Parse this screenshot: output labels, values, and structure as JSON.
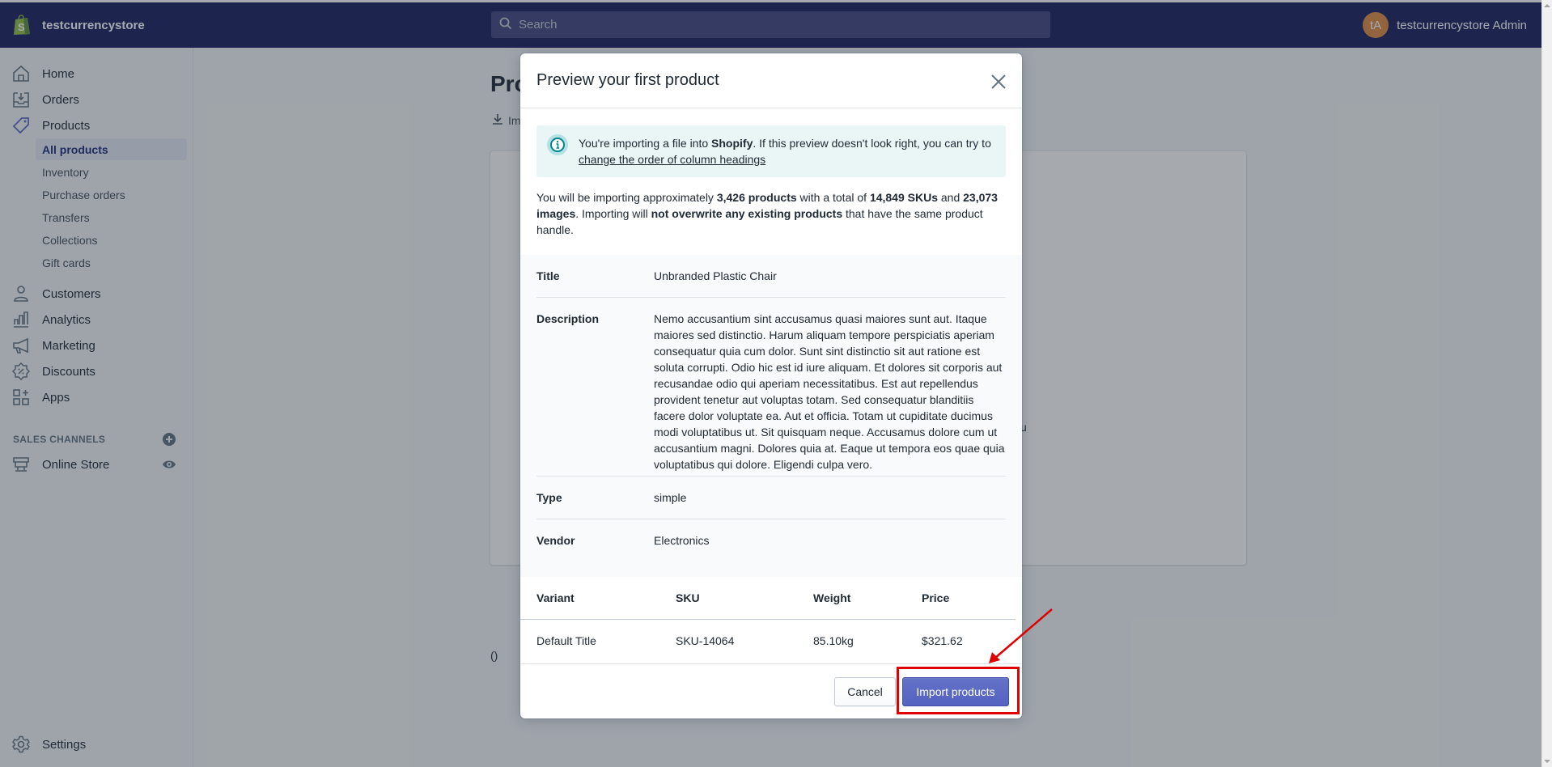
{
  "topbar": {
    "store_name": "testcurrencystore",
    "search_placeholder": "Search",
    "user_initials": "tA",
    "user_name": "testcurrencystore Admin"
  },
  "sidebar": {
    "items": [
      {
        "label": "Home",
        "icon": "home-icon"
      },
      {
        "label": "Orders",
        "icon": "orders-icon"
      },
      {
        "label": "Products",
        "icon": "tag-icon"
      },
      {
        "label": "Customers",
        "icon": "customer-icon"
      },
      {
        "label": "Analytics",
        "icon": "analytics-icon"
      },
      {
        "label": "Marketing",
        "icon": "megaphone-icon"
      },
      {
        "label": "Discounts",
        "icon": "discount-icon"
      },
      {
        "label": "Apps",
        "icon": "apps-icon"
      }
    ],
    "product_subitems": [
      {
        "label": "All products",
        "active": true
      },
      {
        "label": "Inventory"
      },
      {
        "label": "Purchase orders"
      },
      {
        "label": "Transfers"
      },
      {
        "label": "Collections"
      },
      {
        "label": "Gift cards"
      }
    ],
    "sales_channels_title": "SALES CHANNELS",
    "online_store": "Online Store",
    "settings": "Settings"
  },
  "page": {
    "title": "Products",
    "import_label": "Import",
    "bg_fragment_u": "u",
    "bg_fragment_paren": "()"
  },
  "modal": {
    "title": "Preview your first product",
    "banner": {
      "text_before": "You're importing a file into ",
      "text_bold": "Shopify",
      "text_after": ". If this preview doesn't look right, you can try to ",
      "link": "change the order of column headings"
    },
    "summary": {
      "p1": "You will be importing approximately ",
      "products": "3,426 products",
      "p2": " with a total of ",
      "skus": "14,849 SKUs",
      "p3": " and ",
      "images": "23,073 images",
      "p4": ". Importing will ",
      "no_overwrite": "not overwrite any existing products",
      "p5": " that have the same product handle."
    },
    "details": [
      {
        "key": "Title",
        "value": "Unbranded Plastic Chair"
      },
      {
        "key": "Description",
        "value": "Nemo accusantium sint accusamus quasi maiores sunt aut. Itaque maiores sed distinctio. Harum aliquam tempore perspiciatis aperiam consequatur quia cum dolor. Sunt sint distinctio sit aut ratione est soluta corrupti. Odio hic est id iure aliquam. Et dolores sit corporis aut recusandae odio qui aperiam necessitatibus. Est aut repellendus provident tenetur aut voluptas totam. Sed consequatur blanditiis facere dolor voluptate ea. Aut et officia. Totam ut cupiditate ducimus modi voluptatibus ut. Sit quisquam neque. Accusamus dolore cum ut accusantium magni. Dolores quia at. Eaque ut tempora eos quae quia voluptatibus qui dolore. Eligendi culpa vero."
      },
      {
        "key": "Type",
        "value": "simple"
      },
      {
        "key": "Vendor",
        "value": "Electronics"
      }
    ],
    "variants": {
      "headers": [
        "Variant",
        "SKU",
        "Weight",
        "Price"
      ],
      "rows": [
        [
          "Default Title",
          "SKU-14064",
          "85.10kg",
          "$321.62"
        ]
      ]
    },
    "cancel_label": "Cancel",
    "import_label": "Import products"
  },
  "colors": {
    "topbar": "#1c2260",
    "primary": "#5c6ac4",
    "annotation": "#e00000",
    "banner_bg": "#eaf6f6"
  }
}
